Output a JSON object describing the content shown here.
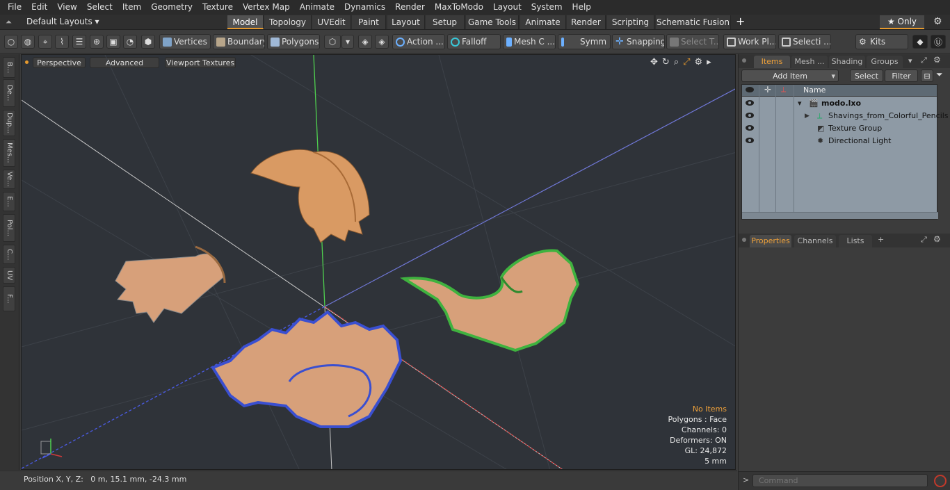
{
  "menu": [
    "File",
    "Edit",
    "View",
    "Select",
    "Item",
    "Geometry",
    "Texture",
    "Vertex Map",
    "Animate",
    "Dynamics",
    "Render",
    "MaxToModo",
    "Layout",
    "System",
    "Help"
  ],
  "layouts": {
    "label": "Default Layouts ▾"
  },
  "tabs": [
    "Model",
    "Topology",
    "UVEdit",
    "Paint",
    "Layout",
    "Setup",
    "Game Tools",
    "Animate",
    "Render",
    "Scripting",
    "Schematic Fusion"
  ],
  "tab_add": "+",
  "only_label": "★ Only",
  "toolbar": {
    "vertices": "Vertices",
    "boundary": "Boundary",
    "polygons": "Polygons",
    "action": "Action ...",
    "falloff": "Falloff",
    "mesh": "Mesh C ...",
    "symm": "Symm ...",
    "snapping": "Snapping",
    "select_t": "Select T...",
    "workpl": "Work Pl...",
    "selecti": "Selecti ...",
    "kits": "Kits"
  },
  "left_tools": [
    "B...",
    "De...",
    "Dup...",
    "Mes...",
    "Ve...",
    "E...",
    "Pol...",
    "C...",
    "UV",
    "F..."
  ],
  "viewport": {
    "view_mode": "Perspective",
    "shading": "Advanced",
    "textures": "Viewport Textures"
  },
  "hud": {
    "items": "No Items",
    "polygons": "Polygons : Face",
    "channels": "Channels: 0",
    "deformers": "Deformers: ON",
    "gl": "GL: 24,872",
    "scale": "5 mm"
  },
  "status": {
    "position": "Position X, Y, Z:   0 m, 15.1 mm, -24.3 mm"
  },
  "panel": {
    "tabs": [
      "Items",
      "Mesh ...",
      "Shading",
      "Groups"
    ],
    "add_item": "Add Item",
    "select": "Select",
    "filter": "Filter",
    "col_name": "Name",
    "items": [
      {
        "label": "modo.lxo",
        "bold": true
      },
      {
        "label": "Shavings_from_Colorful_Pencils"
      },
      {
        "label": "Texture Group"
      },
      {
        "label": "Directional Light"
      }
    ]
  },
  "props": {
    "tabs": [
      "Properties",
      "Channels",
      "Lists",
      "+"
    ]
  },
  "command": {
    "placeholder": "Command"
  },
  "colors": {
    "accent": "#e69a2e",
    "viewport_bg": "#2f3339",
    "items_bg": "#8e9aa5"
  }
}
